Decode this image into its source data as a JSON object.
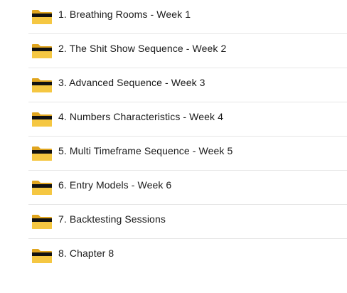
{
  "folders": [
    {
      "label": "1. Breathing Rooms - Week 1",
      "icon": "folder-icon"
    },
    {
      "label": "2. The Shit Show Sequence - Week 2",
      "icon": "folder-icon"
    },
    {
      "label": "3. Advanced Sequence - Week 3",
      "icon": "folder-icon"
    },
    {
      "label": "4. Numbers Characteristics - Week 4",
      "icon": "folder-icon"
    },
    {
      "label": "5. Multi Timeframe Sequence - Week 5",
      "icon": "folder-icon"
    },
    {
      "label": "6. Entry Models - Week 6",
      "icon": "folder-icon"
    },
    {
      "label": "7. Backtesting Sessions",
      "icon": "folder-icon"
    },
    {
      "label": "8. Chapter 8",
      "icon": "folder-icon"
    }
  ],
  "colors": {
    "folder_front": "#f5c742",
    "folder_back": "#e0a51f",
    "folder_dark_band": "#111111",
    "text": "#1a1a1a",
    "divider": "#e6e6e6"
  }
}
